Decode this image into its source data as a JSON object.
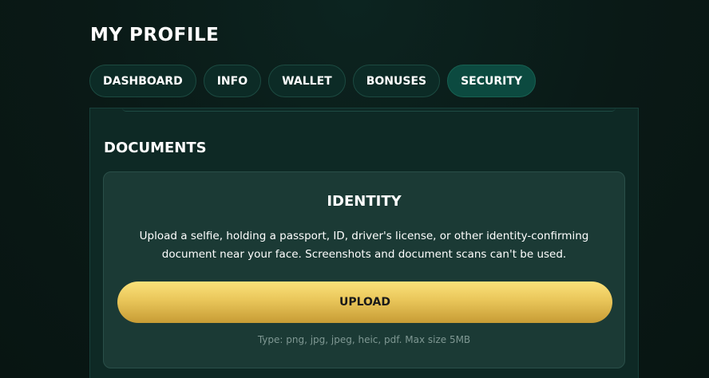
{
  "page": {
    "title": "MY PROFILE"
  },
  "tabs": [
    {
      "label": "DASHBOARD",
      "active": false
    },
    {
      "label": "INFO",
      "active": false
    },
    {
      "label": "WALLET",
      "active": false
    },
    {
      "label": "BONUSES",
      "active": false
    },
    {
      "label": "SECURITY",
      "active": true
    }
  ],
  "documents": {
    "section_title": "DOCUMENTS",
    "identity": {
      "title": "IDENTITY",
      "description_line1": "Upload a selfie, holding a passport, ID, driver's license, or other identity-confirming",
      "description_line2": "document near your face. Screenshots and document scans can't be used.",
      "upload_label": "UPLOAD",
      "file_hint": "Type: png, jpg, jpeg, heic, pdf. Max size 5MB"
    }
  },
  "colors": {
    "background": "#0a1a17",
    "panel": "#0e2925",
    "card": "#1b3a35",
    "tab": "#0c2b26",
    "tab_active": "#0c4a40",
    "button_gold_top": "#fbe27a",
    "button_gold_bottom": "#c79c35"
  }
}
